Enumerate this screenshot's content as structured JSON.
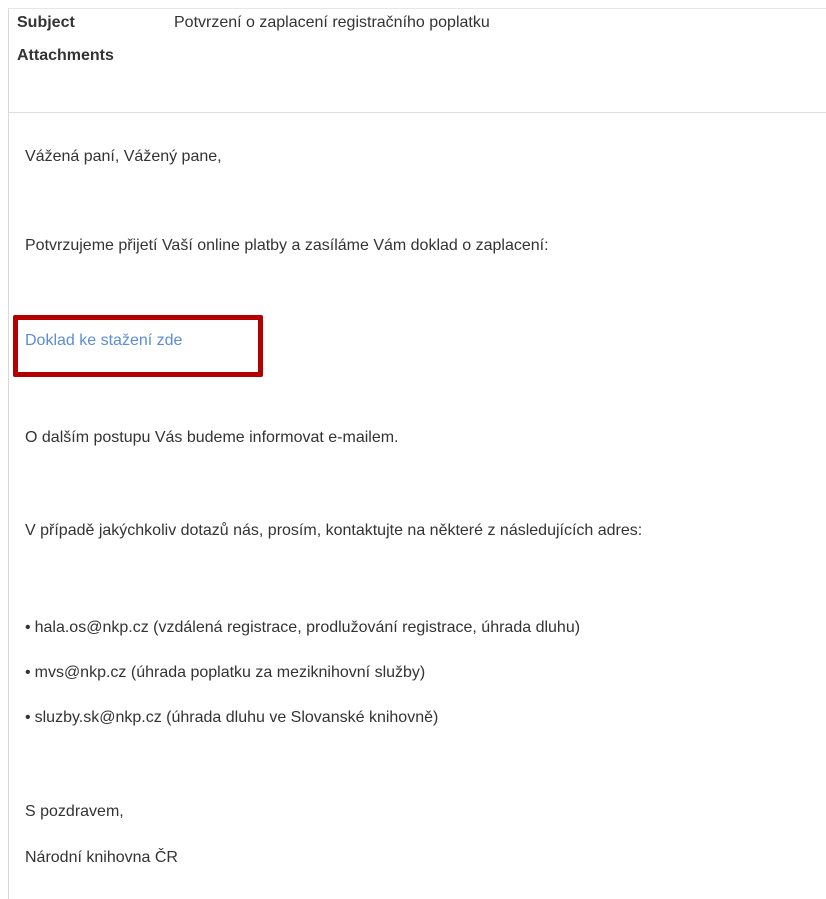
{
  "email": {
    "subject_label": "Subject",
    "subject_value": "Potvrzení o zaplacení registračního poplatku",
    "attachments_label": "Attachments",
    "body": {
      "greeting": "Vážená paní, Vážený pane,",
      "confirmation": "Potvrzujeme přijetí Vaší online platby a zasíláme Vám doklad o zaplacení:",
      "receipt_link": "Doklad ke stažení zde",
      "next_steps": "O dalším postupu Vás budeme informovat e-mailem.",
      "contact_intro": "V případě jakýchkoliv dotazů nás, prosím, kontaktujte na některé z následujících adres:",
      "contacts": [
        "hala.os@nkp.cz (vzdálená registrace, prodlužování registrace, úhrada dluhu)",
        "mvs@nkp.cz (úhrada poplatku za meziknihovní služby)",
        "sluzby.sk@nkp.cz (úhrada dluhu ve Slovanské knihovně)"
      ],
      "closing": "S pozdravem,",
      "signature": "Národní knihovna ČR"
    },
    "bullet_char": "•",
    "highlight_color": "#b40000",
    "link_color": "#5b8dd6"
  }
}
